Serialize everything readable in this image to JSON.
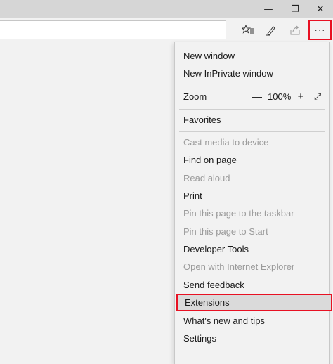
{
  "window": {
    "minimize_glyph": "—",
    "restore_glyph": "❐",
    "close_glyph": "✕"
  },
  "toolbar": {
    "favorites_glyph": "☆≡",
    "notes_glyph": "✎",
    "share_glyph": "⇪",
    "more_glyph": "···"
  },
  "menu": {
    "new_window": "New window",
    "new_inprivate": "New InPrivate window",
    "zoom_label": "Zoom",
    "zoom_minus": "—",
    "zoom_value": "100%",
    "zoom_plus": "+",
    "zoom_fullscreen": "⤢",
    "favorites": "Favorites",
    "cast": "Cast media to device",
    "find": "Find on page",
    "read_aloud": "Read aloud",
    "print": "Print",
    "pin_taskbar": "Pin this page to the taskbar",
    "pin_start": "Pin this page to Start",
    "dev_tools": "Developer Tools",
    "open_ie": "Open with Internet Explorer",
    "feedback": "Send feedback",
    "extensions": "Extensions",
    "whats_new": "What's new and tips",
    "settings": "Settings"
  },
  "colors": {
    "highlight_border": "#e81123",
    "disabled_text": "#9b9b9b"
  }
}
